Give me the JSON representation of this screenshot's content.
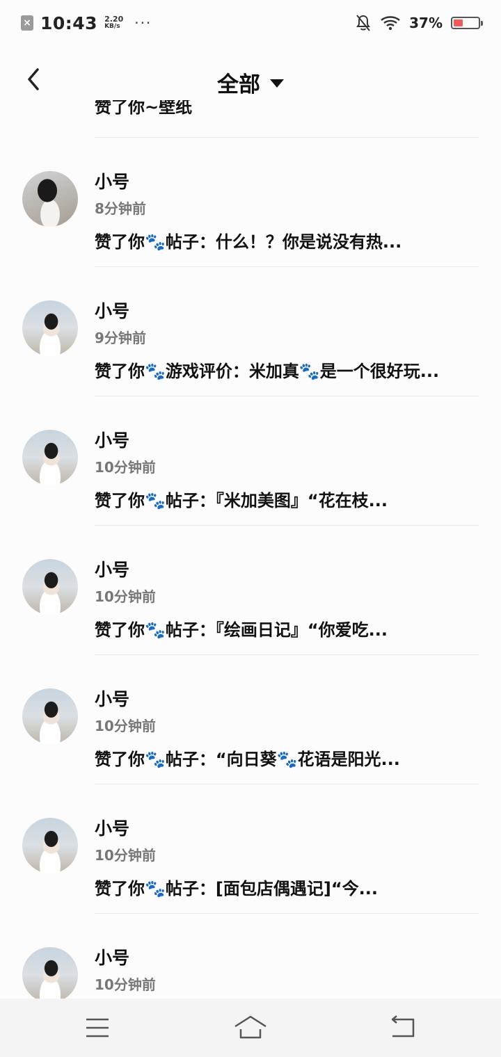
{
  "status_bar": {
    "close_badge": "×",
    "time": "10:43",
    "speed_value": "2.20",
    "speed_unit": "KB/s",
    "more": "···",
    "battery_pct": "37%",
    "battery_level": 0.37,
    "battery_color": "#ee5b5b"
  },
  "nav": {
    "title": "全部"
  },
  "partial_item": {
    "desc": "赞了你~壁纸"
  },
  "items": [
    {
      "name": "小号",
      "time": "8分钟前",
      "desc": "赞了你🐾帖子：什么！？你是说没有热..."
    },
    {
      "name": "小号",
      "time": "9分钟前",
      "desc": "赞了你🐾游戏评价：米加真🐾是一个很好玩..."
    },
    {
      "name": "小号",
      "time": "10分钟前",
      "desc": "赞了你🐾帖子：『米加美图』“花在枝..."
    },
    {
      "name": "小号",
      "time": "10分钟前",
      "desc": "赞了你🐾帖子：『绘画日记』“你爱吃..."
    },
    {
      "name": "小号",
      "time": "10分钟前",
      "desc": "赞了你🐾帖子：“向日葵🐾花语是阳光..."
    },
    {
      "name": "小号",
      "time": "10分钟前",
      "desc": "赞了你🐾帖子：[面包店偶遇记]“今..."
    },
    {
      "name": "小号",
      "time": "10分钟前",
      "desc": ""
    }
  ]
}
